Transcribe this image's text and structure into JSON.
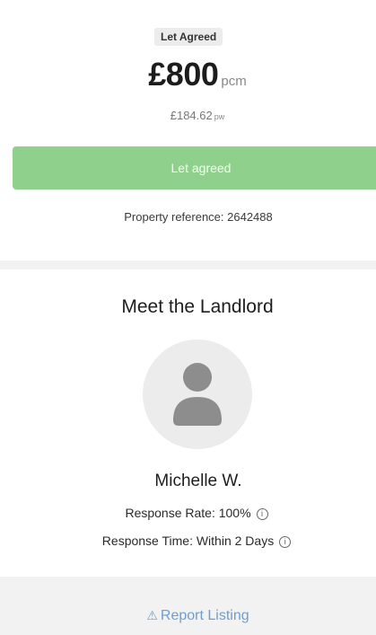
{
  "listing": {
    "status_badge": "Let Agreed",
    "price": "£800",
    "price_unit": "pcm",
    "weekly_price": "£184.62",
    "weekly_unit": "pw",
    "status_button": "Let agreed",
    "property_reference": "Property reference: 2642488"
  },
  "landlord": {
    "heading": "Meet the Landlord",
    "name": "Michelle W.",
    "response_rate": "Response Rate: 100%",
    "response_time": "Response Time: Within 2 Days"
  },
  "footer": {
    "report_link": "Report Listing"
  },
  "icons": {
    "info": "info-circle-icon",
    "warning": "warning-triangle-icon",
    "avatar": "user-placeholder-icon"
  },
  "colors": {
    "status_button": "#8fd08c",
    "link": "#6f9fcf",
    "badge_bg": "#ececec",
    "page_bg": "#f2f2f2"
  }
}
